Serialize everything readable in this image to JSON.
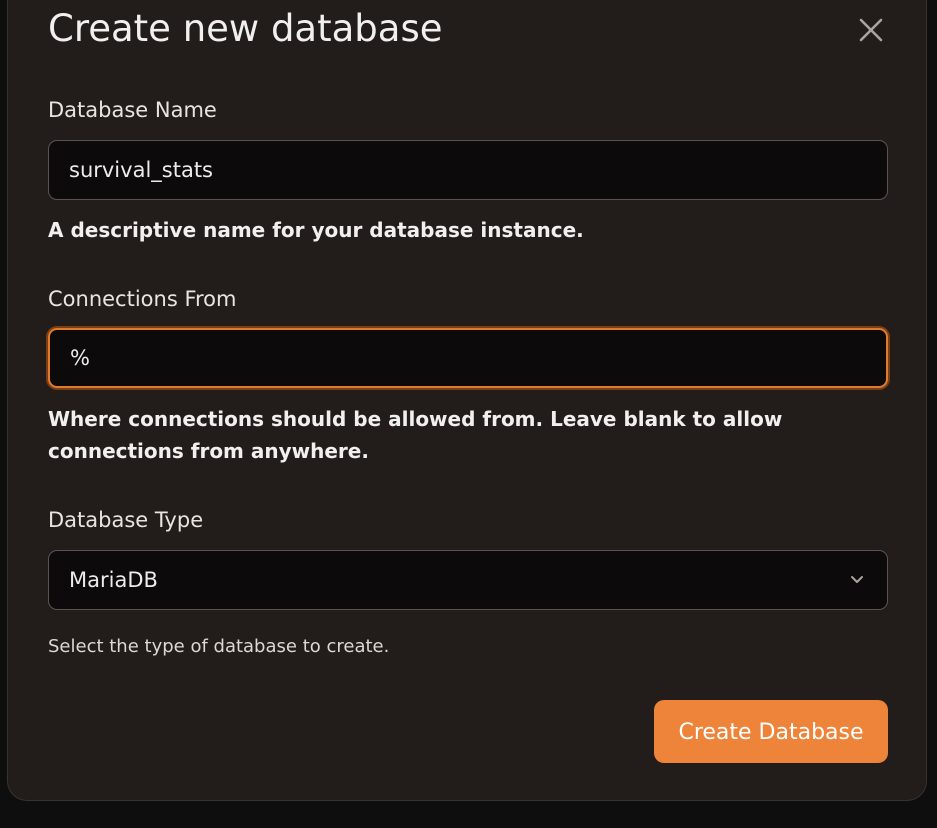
{
  "dialog": {
    "title": "Create new database",
    "close_icon": "close-icon"
  },
  "fields": {
    "name": {
      "label": "Database Name",
      "value": "survival_stats",
      "help": "A descriptive name for your database instance."
    },
    "connections": {
      "label": "Connections From",
      "value": "%",
      "help": "Where connections should be allowed from. Leave blank to allow connections from anywhere."
    },
    "type": {
      "label": "Database Type",
      "value": "MariaDB",
      "icon": "chevron-down-icon",
      "help": "Select the type of database to create."
    }
  },
  "actions": {
    "submit_label": "Create Database"
  },
  "colors": {
    "accent": "#ee833a",
    "focus_ring": "#e07a2e",
    "dialog_bg": "#221c1a",
    "input_bg": "#0c0a0a"
  }
}
